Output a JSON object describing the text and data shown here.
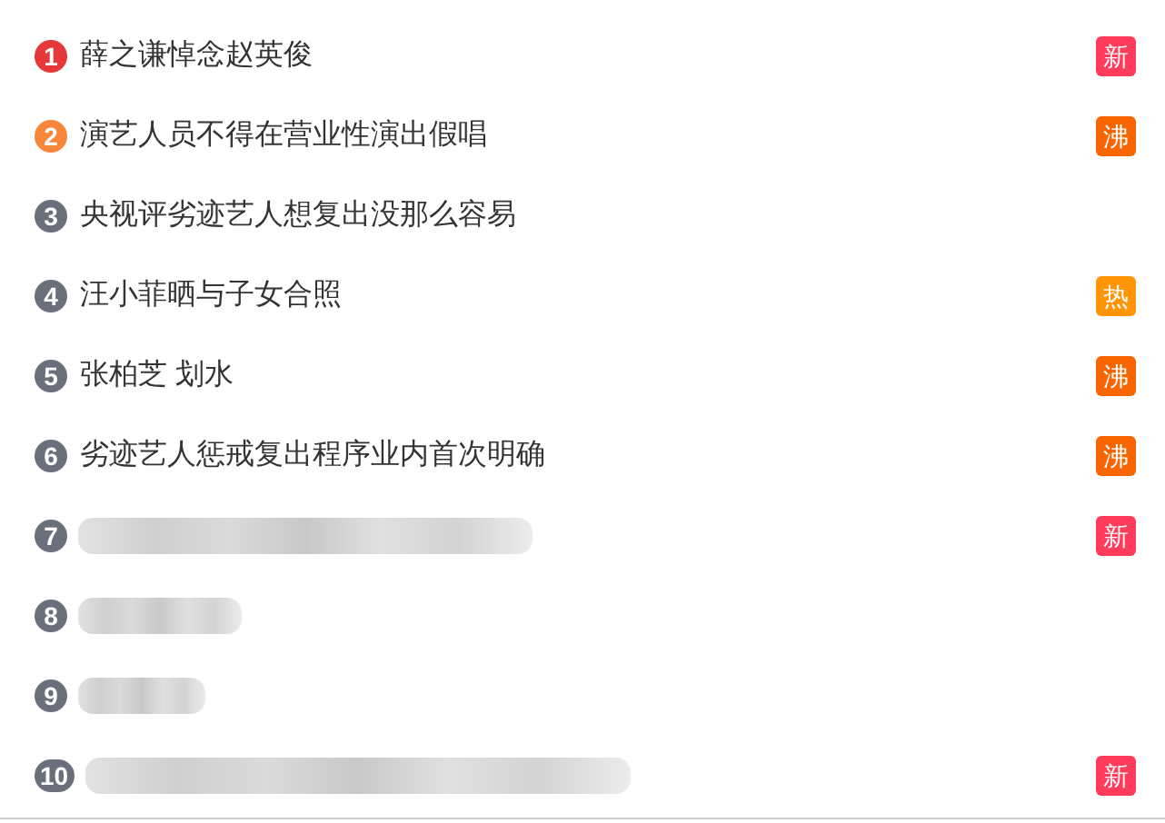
{
  "hot_list": [
    {
      "rank": {
        "label": "1",
        "color": "#e5383b"
      },
      "kind": "text",
      "title": "薛之谦悼念赵英俊",
      "tag": {
        "label": "新",
        "color": "#ff3b5c"
      }
    },
    {
      "rank": {
        "label": "2",
        "color": "#f7863a"
      },
      "kind": "text",
      "title": "演艺人员不得在营业性演出假唱",
      "tag": {
        "label": "沸",
        "color": "#f86400"
      }
    },
    {
      "rank": {
        "label": "3",
        "color": "#6b6f7c"
      },
      "kind": "text",
      "title": "央视评劣迹艺人想复出没那么容易"
    },
    {
      "rank": {
        "label": "4",
        "color": "#6b6f7c"
      },
      "kind": "text",
      "title": "汪小菲晒与子女合照",
      "tag": {
        "label": "热",
        "color": "#ff9406"
      }
    },
    {
      "rank": {
        "label": "5",
        "color": "#6b6f7c"
      },
      "kind": "text",
      "title": "张柏芝 划水",
      "tag": {
        "label": "沸",
        "color": "#f86400"
      }
    },
    {
      "rank": {
        "label": "6",
        "color": "#6b6f7c"
      },
      "kind": "text",
      "title": "劣迹艺人惩戒复出程序业内首次明确",
      "tag": {
        "label": "沸",
        "color": "#f86400"
      }
    },
    {
      "rank": {
        "label": "7",
        "color": "#6b6f7c"
      },
      "kind": "redacted",
      "tag": {
        "label": "新",
        "color": "#ff3b5c"
      }
    },
    {
      "rank": {
        "label": "8",
        "color": "#6b6f7c"
      },
      "kind": "redacted"
    },
    {
      "rank": {
        "label": "9",
        "color": "#6b6f7c"
      },
      "kind": "redacted"
    },
    {
      "rank": {
        "label": "10",
        "color": "#6b6f7c"
      },
      "kind": "redacted",
      "tag": {
        "label": "新",
        "color": "#ff3b5c"
      }
    }
  ]
}
